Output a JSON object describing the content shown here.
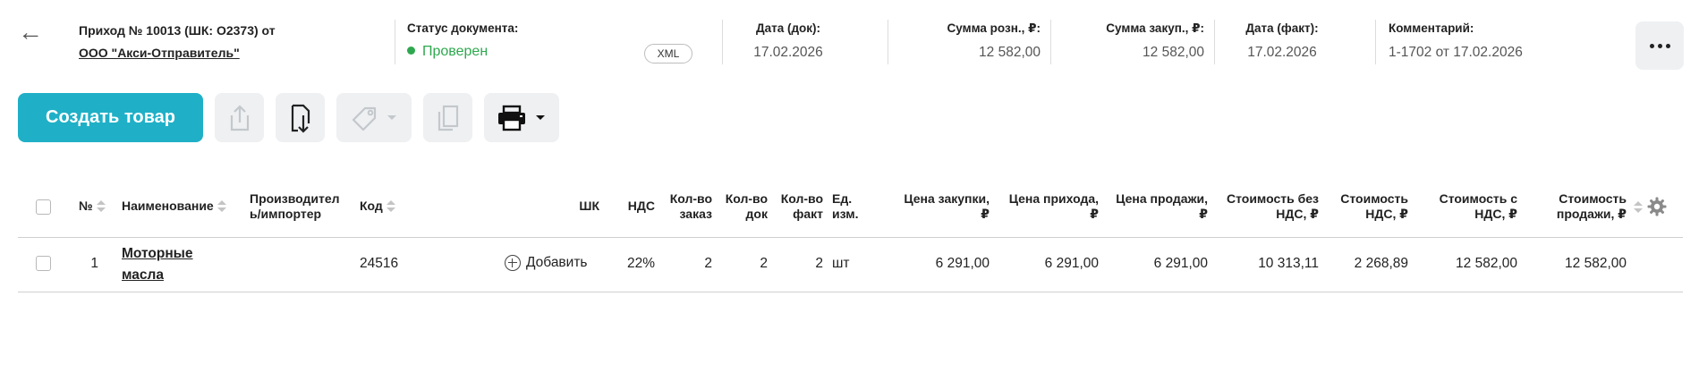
{
  "header": {
    "title": "Приход № 10013 (ШК: О2373) от",
    "supplier": "ООО \"Акси-Отправитель\"",
    "status_label": "Статус документа:",
    "status_value": "Проверен",
    "status_color": "#2ea84f",
    "xml_badge": "XML",
    "doc_date_label": "Дата (док):",
    "doc_date": "17.02.2026",
    "retail_sum_label": "Сумма розн., ₽:",
    "retail_sum": "12 582,00",
    "purchase_sum_label": "Сумма закуп., ₽:",
    "purchase_sum": "12 582,00",
    "fact_date_label": "Дата (факт):",
    "fact_date": "17.02.2026",
    "comment_label": "Комментарий:",
    "comment": "1-1702 от 17.02.2026"
  },
  "toolbar": {
    "create_label": "Создать товар",
    "accent_color": "#1fb0c7",
    "icons": [
      "share-icon",
      "download-document-icon",
      "price-tag-icon",
      "copy-icon",
      "printer-icon"
    ]
  },
  "table": {
    "columns": {
      "num": "№",
      "name": "Наименование",
      "maker_line1": "Производител",
      "maker_line2": "ь/импортер",
      "code": "Код",
      "barcode": "ШК",
      "vat": "НДС",
      "qty_order_1": "Кол-во",
      "qty_order_2": "заказ",
      "qty_doc_1": "Кол-во",
      "qty_doc_2": "док",
      "qty_fact_1": "Кол-во",
      "qty_fact_2": "факт",
      "unit_1": "Ед.",
      "unit_2": "изм.",
      "price_purchase_1": "Цена закупки,",
      "price_purchase_2": "₽",
      "price_income_1": "Цена прихода,",
      "price_income_2": "₽",
      "price_sale_1": "Цена продажи,",
      "price_sale_2": "₽",
      "cost_novat_1": "Стоимость без",
      "cost_novat_2": "НДС, ₽",
      "cost_vat_1": "Стоимость",
      "cost_vat_2": "НДС, ₽",
      "cost_withvat_1": "Стоимость с",
      "cost_withvat_2": "НДС, ₽",
      "cost_sale_1": "Стоимость",
      "cost_sale_2": "продажи, ₽"
    },
    "rows": [
      {
        "num": "1",
        "name_line1": "Моторные",
        "name_line2": "масла",
        "maker": "",
        "code": "24516",
        "barcode_action": "Добавить",
        "vat": "22%",
        "qty_order": "2",
        "qty_doc": "2",
        "qty_fact": "2",
        "unit": "шт",
        "price_purchase": "6 291,00",
        "price_income": "6 291,00",
        "price_sale": "6 291,00",
        "cost_novat": "10 313,11",
        "cost_vat": "2 268,89",
        "cost_withvat": "12 582,00",
        "cost_sale": "12 582,00"
      }
    ]
  }
}
